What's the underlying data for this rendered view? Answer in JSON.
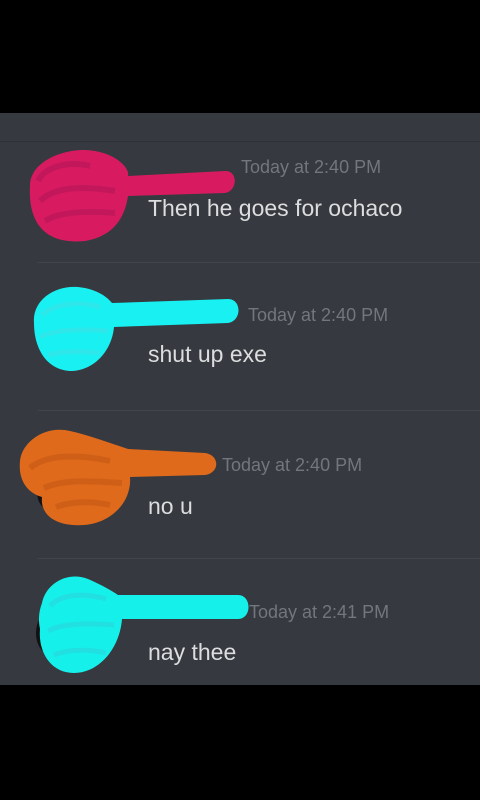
{
  "messages": [
    {
      "timestamp": "Today at 2:40 PM",
      "text": "Then he goes for ochaco",
      "scribble_color": "#d81b60"
    },
    {
      "timestamp": "Today at 2:40 PM",
      "text": "shut up exe",
      "scribble_color": "#18f0f2"
    },
    {
      "timestamp": "Today at 2:40 PM",
      "text": "no u",
      "scribble_color": "#e06a1c"
    },
    {
      "timestamp": "Today at 2:41 PM",
      "text": "nay thee",
      "scribble_color": "#16f0ea"
    }
  ],
  "colors": {
    "background": "#36393f",
    "letterbox": "#000000",
    "timestamp": "#72767d",
    "message_text": "#dcddde"
  }
}
